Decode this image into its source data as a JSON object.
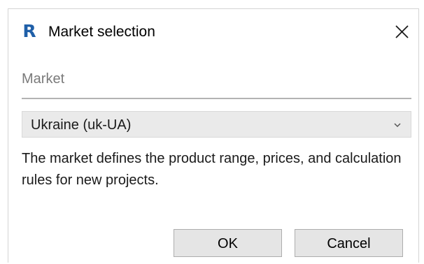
{
  "window": {
    "title": "Market selection",
    "app_icon_letter": "R",
    "app_icon_color": "#1f5fa8"
  },
  "market": {
    "section_label": "Market",
    "selected": "Ukraine (uk-UA)",
    "description": "The market defines the product range, prices, and calculation rules for new projects."
  },
  "buttons": {
    "ok_label": "OK",
    "cancel_label": "Cancel"
  },
  "icons": {
    "close": "close-icon",
    "dropdown": "chevron-down-icon"
  }
}
